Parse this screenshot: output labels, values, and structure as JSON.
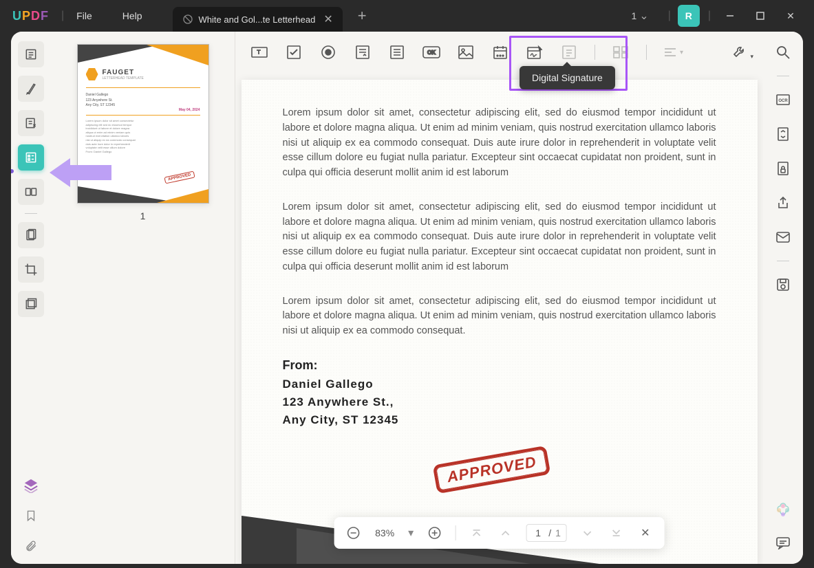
{
  "app": {
    "logo_u": "U",
    "logo_p": "P",
    "logo_d": "D",
    "logo_f": "F"
  },
  "menu": {
    "file": "File",
    "help": "Help"
  },
  "tab": {
    "title": "White and Gol...te Letterhead"
  },
  "title_right": {
    "count": "1",
    "avatar_letter": "R"
  },
  "tooltip": {
    "digital_signature": "Digital Signature"
  },
  "thumbnail": {
    "brand": "FAUGET",
    "brand_sub": "LETTERHEAD TEMPLATE",
    "addr": "Daniel Gallego\n123 Anywhere St.\nAny City, ST 12345",
    "date": "May 04, 2024",
    "stamp": "APPROVED",
    "page_num": "1"
  },
  "document": {
    "para1": "Lorem ipsum dolor sit amet, consectetur adipiscing elit, sed do eiusmod tempor incididunt ut labore et dolore magna aliqua. Ut enim ad minim veniam, quis nostrud exercitation ullamco laboris nisi ut aliquip ex ea commodo consequat. Duis aute irure dolor in reprehenderit in voluptate velit esse cillum dolore eu fugiat nulla pariatur. Excepteur sint occaecat cupidatat non proident, sunt in culpa qui officia deserunt mollit anim id est laborum",
    "para2": "Lorem ipsum dolor sit amet, consectetur adipiscing elit, sed do eiusmod tempor incididunt ut labore et dolore magna aliqua. Ut enim ad minim veniam, quis nostrud exercitation ullamco laboris nisi ut aliquip ex ea commodo consequat. Duis aute irure dolor in reprehenderit in voluptate velit esse cillum dolore eu fugiat nulla pariatur. Excepteur sint occaecat cupidatat non proident, sunt in culpa qui officia deserunt mollit anim id est laborum",
    "para3": "Lorem ipsum dolor sit amet, consectetur adipiscing elit, sed do eiusmod tempor incididunt ut labore et dolore magna aliqua. Ut enim ad minim veniam, quis nostrud exercitation ullamco laboris nisi ut aliquip ex ea commodo consequat.",
    "from_label": "From:",
    "from_name": "Daniel Gallego",
    "from_street": "123 Anywhere St.,",
    "from_city": "Any City, ST 12345",
    "stamp_text": "APPROVED"
  },
  "nav": {
    "zoom": "83%",
    "cur_page": "1",
    "total_pages": "1"
  }
}
